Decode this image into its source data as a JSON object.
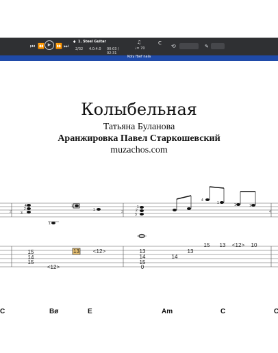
{
  "toolbar": {
    "rewind_icon": "skip-back-icon",
    "back_icon": "rewind-icon",
    "play_icon": "play-icon",
    "forward_icon": "fast-forward-icon",
    "end_icon": "skip-end-icon",
    "track_name": "1. Steel Guitar",
    "bar_position": "2/32",
    "time_signature": "4.0:4.0",
    "time_position": "00:03 / 02:31",
    "tempo": "♩= 70",
    "key_symbol": "C",
    "loop_icon": "loop-icon",
    "pencil_icon": "pencil-icon"
  },
  "window_title": "Koly fbef nala",
  "score": {
    "title": "Колыбельная",
    "artist": "Татьяна Буланова",
    "arranger": "Аранжировка Павел Старкошевский",
    "website": "muzachos.com",
    "tab_numbers": [
      "15",
      "14",
      "15",
      "<12>",
      "13",
      "<12>",
      "13",
      "14",
      "15",
      "0",
      "13",
      "14",
      "15",
      "13",
      "<12>",
      "10"
    ],
    "measure_numbers": [
      "2",
      "3",
      "4"
    ],
    "chords": [
      "C",
      "Bø",
      "E",
      "Am",
      "C",
      "C"
    ]
  }
}
